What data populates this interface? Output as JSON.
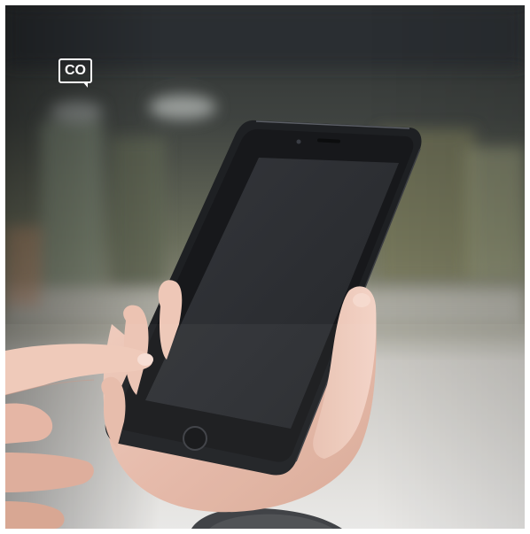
{
  "logo": {
    "text": "CO"
  },
  "colors": {
    "phone_body": "#1e2023",
    "phone_screen": "#2e3035",
    "skin": "#e8bfae",
    "background_blur": "#5d6155",
    "sweater": "#3a3c40"
  },
  "icons": {
    "logo": "speech-bubble-logo"
  }
}
